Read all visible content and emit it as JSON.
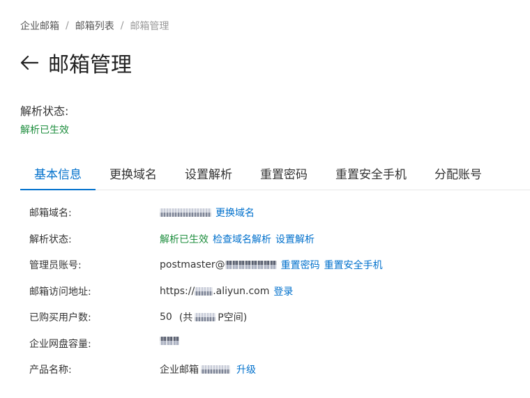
{
  "breadcrumb": {
    "items": [
      "企业邮箱",
      "邮箱列表",
      "邮箱管理"
    ],
    "separator": "/"
  },
  "header": {
    "title": "邮箱管理",
    "back_icon": "arrow-left-icon"
  },
  "resolution": {
    "label": "解析状态:",
    "value": "解析已生效"
  },
  "tabs": [
    {
      "label": "基本信息",
      "active": true
    },
    {
      "label": "更换域名",
      "active": false
    },
    {
      "label": "设置解析",
      "active": false
    },
    {
      "label": "重置密码",
      "active": false
    },
    {
      "label": "重置安全手机",
      "active": false
    },
    {
      "label": "分配账号",
      "active": false
    }
  ],
  "info": {
    "domain": {
      "label": "邮箱域名:",
      "link": "更换域名"
    },
    "resolution": {
      "label": "解析状态:",
      "status": "解析已生效",
      "links": [
        "检查域名解析",
        "设置解析"
      ]
    },
    "admin": {
      "label": "管理员账号:",
      "prefix": "postmaster@",
      "links": [
        "重置密码",
        "重置安全手机"
      ]
    },
    "access": {
      "label": "邮箱访问地址:",
      "prefix": "https://",
      "suffix": ".aliyun.com",
      "link": "登录"
    },
    "users": {
      "label": "已购买用户数:",
      "count": "50",
      "detail_open": "(共",
      "detail_close": "P空间)"
    },
    "disk": {
      "label": "企业网盘容量:"
    },
    "product": {
      "label": "产品名称:",
      "prefix": "企业邮箱",
      "link": "升级"
    }
  },
  "colors": {
    "accent": "#0070cc",
    "success": "#1e8e3e",
    "text": "#333333",
    "muted": "#999999"
  }
}
